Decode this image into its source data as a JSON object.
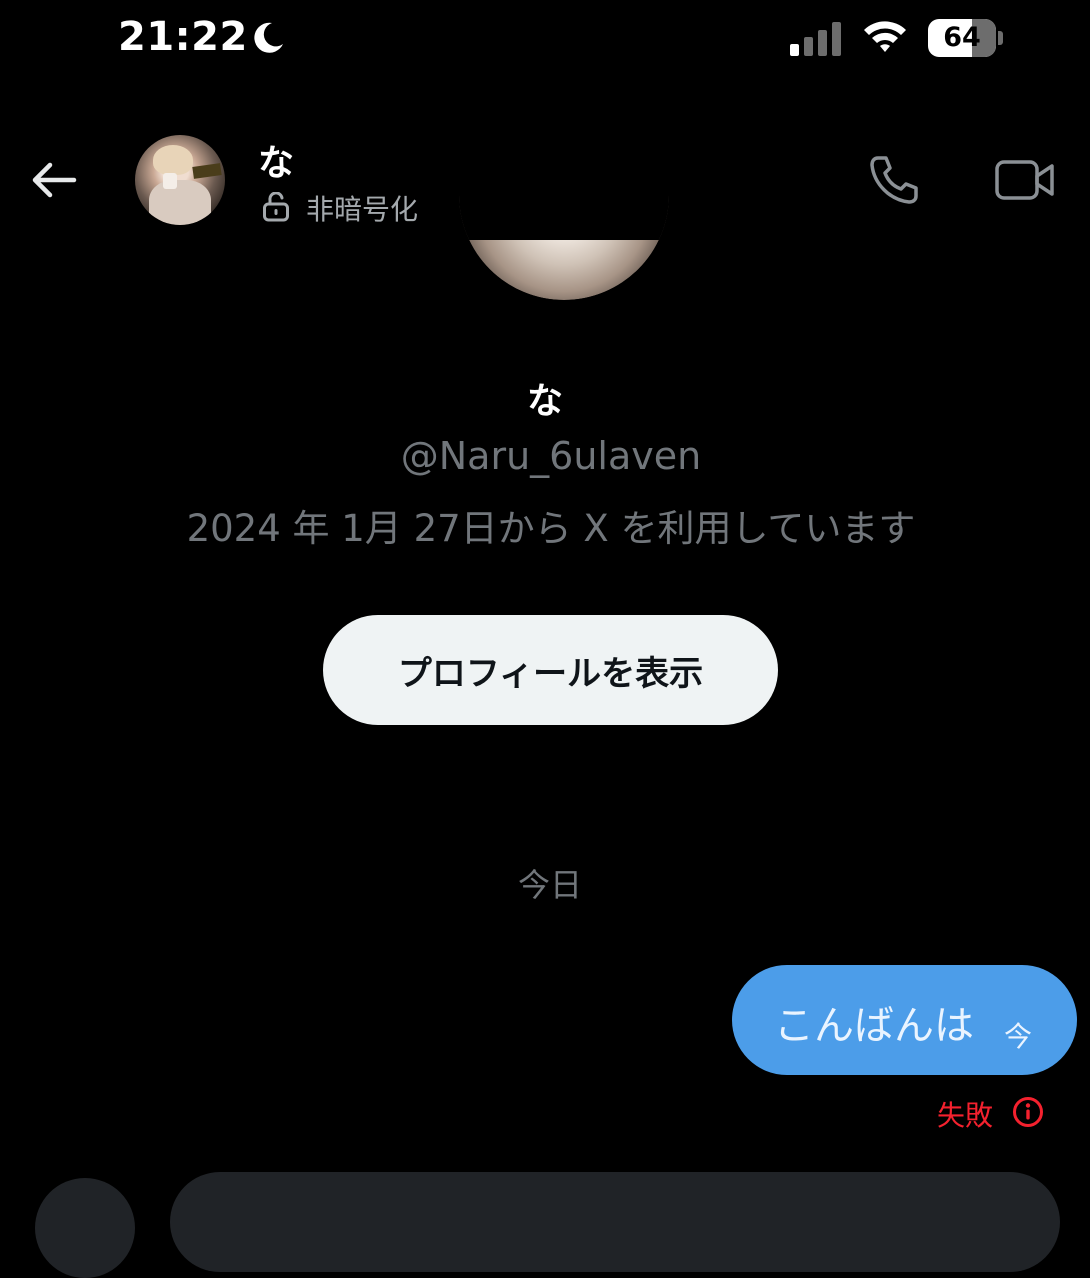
{
  "status_bar": {
    "time": "21:22",
    "battery_percent": "64",
    "battery_level": 0.64,
    "icons": [
      "moon-icon",
      "signal-icon",
      "wifi-icon",
      "battery-icon"
    ]
  },
  "header": {
    "name": "な",
    "encryption_label": "非暗号化",
    "icons": [
      "back-arrow-icon",
      "unlock-icon",
      "phone-icon",
      "video-camera-icon"
    ]
  },
  "profile": {
    "name": "な",
    "handle": "@Naru_6ulaven",
    "joined": "2024 年 1月 27日から X を利用しています",
    "view_profile_label": "プロフィールを表示"
  },
  "conversation": {
    "date_separator": "今日",
    "messages": [
      {
        "text": "こんばんは",
        "time": "今",
        "status": "失敗"
      }
    ]
  },
  "colors": {
    "background": "#000000",
    "bubble": "#4c9de9",
    "error": "#f4212e",
    "muted": "#71767b"
  }
}
